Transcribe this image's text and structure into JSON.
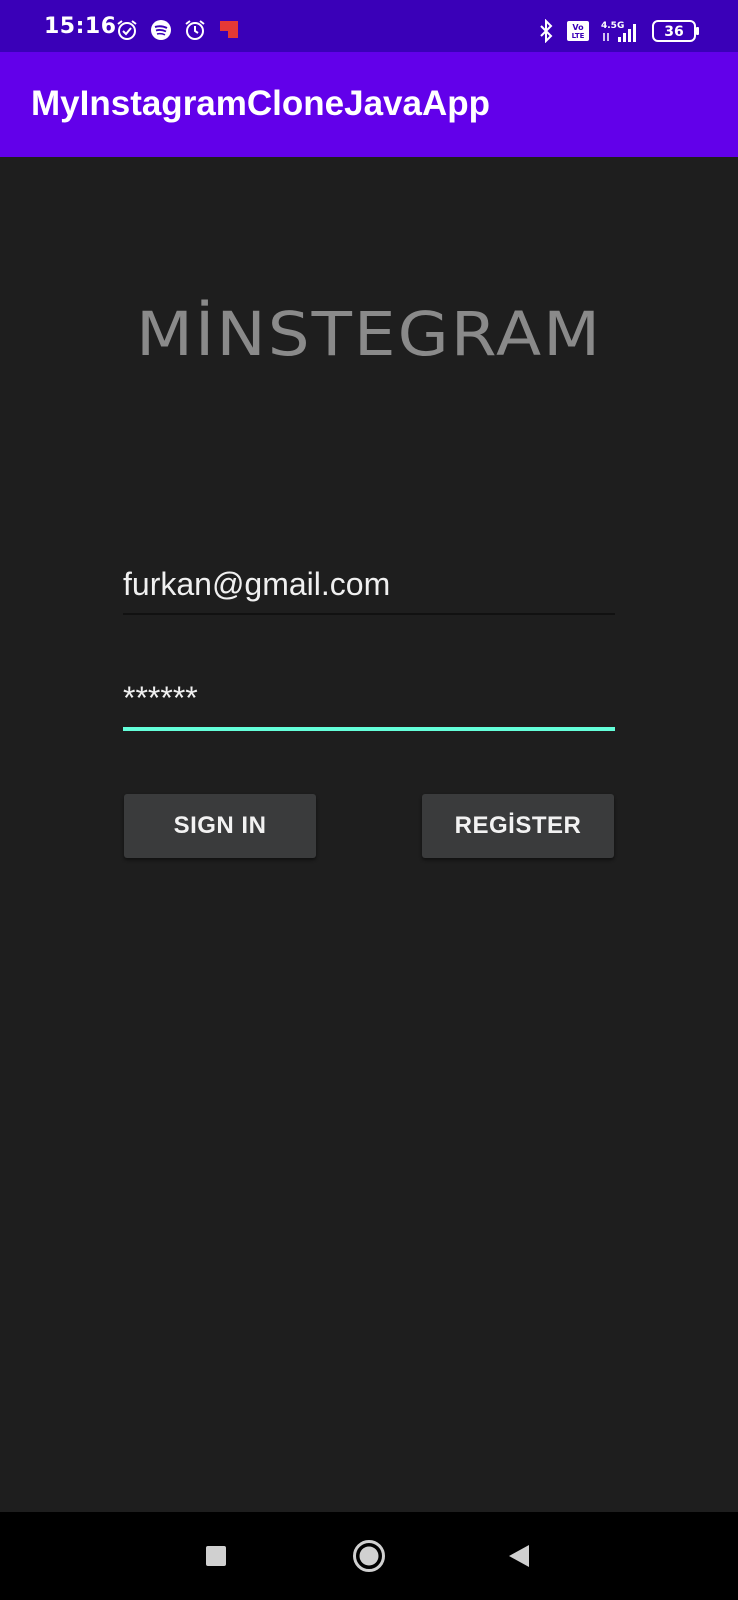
{
  "status_bar": {
    "time": "15:16",
    "left_icons": [
      "alarm-check-icon",
      "spotify-icon",
      "alarm-icon",
      "app-notification-icon"
    ],
    "right_icons": [
      "bluetooth-icon",
      "volte-icon",
      "signal-4-5g-icon",
      "battery-icon"
    ],
    "network": "4.5G",
    "volte": "Vo\nLTE",
    "battery": "36"
  },
  "app_bar": {
    "title": "MyInstagramCloneJavaApp",
    "color": "#6200ea"
  },
  "logo": {
    "text": "MİNSTEGRAM"
  },
  "form": {
    "email_value": "furkan@gmail.com",
    "password_value": "******",
    "accent_color": "#64ffda"
  },
  "buttons": {
    "sign_in": "SIGN IN",
    "register": "REGİSTER"
  },
  "nav_bar": {
    "icons": [
      "recents-square-icon",
      "home-circle-icon",
      "back-triangle-icon"
    ]
  }
}
